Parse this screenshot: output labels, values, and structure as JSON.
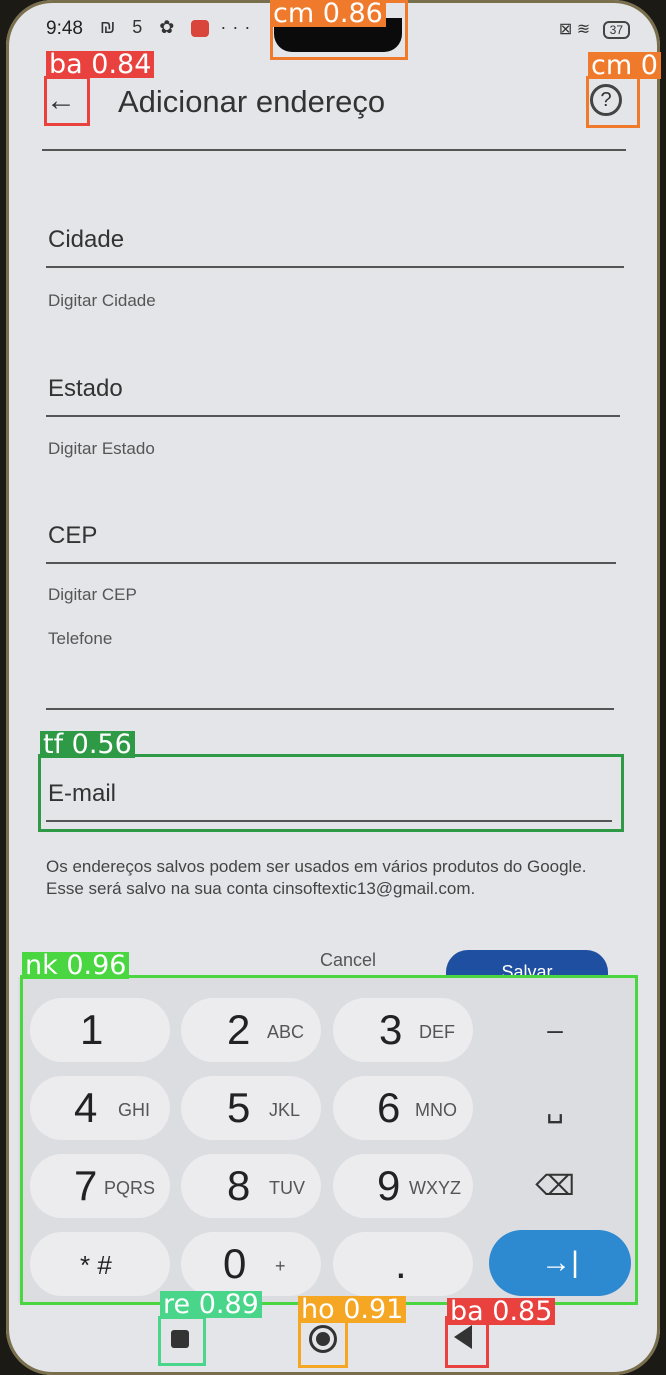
{
  "status_bar": {
    "time": "9:48",
    "left_icons": "₪ 5 ✿",
    "dots": "···",
    "right_icons": "⊠ ≋",
    "battery": "37"
  },
  "app_bar": {
    "back_glyph": "←",
    "title": "Adicionar endereço",
    "help_glyph": "?"
  },
  "form": {
    "city": {
      "label": "Cidade",
      "hint": "Digitar Cidade"
    },
    "state": {
      "label": "Estado",
      "hint": "Digitar Estado"
    },
    "zip": {
      "label": "CEP",
      "hint": "Digitar CEP"
    },
    "phone": {
      "label": "Telefone"
    },
    "email": {
      "label": "E-mail"
    }
  },
  "note": "Os endereços salvos podem ser usados em vários produtos do Google. Esse será salvo na sua conta cinsoftextic13@gmail.com.",
  "actions": {
    "cancel": "Cancel",
    "save": "Salvar"
  },
  "keyboard": {
    "keys": [
      {
        "digit": "1",
        "letters": ""
      },
      {
        "digit": "2",
        "letters": "ABC"
      },
      {
        "digit": "3",
        "letters": "DEF"
      },
      {
        "digit": "4",
        "letters": "GHI"
      },
      {
        "digit": "5",
        "letters": "JKL"
      },
      {
        "digit": "6",
        "letters": "MNO"
      },
      {
        "digit": "7",
        "letters": "PQRS"
      },
      {
        "digit": "8",
        "letters": "TUV"
      },
      {
        "digit": "9",
        "letters": "WXYZ"
      },
      {
        "digit": "* #",
        "letters": ""
      },
      {
        "digit": "0",
        "letters": "+"
      },
      {
        "digit": ".",
        "letters": ""
      }
    ],
    "side_keys": [
      "–",
      "␣",
      "⌫"
    ],
    "next_glyph": "→|"
  },
  "detections": [
    {
      "label": "cm 0.86",
      "color": "#f07a2b"
    },
    {
      "label": "ba 0.84",
      "color": "#e8413e"
    },
    {
      "label": "cm 0",
      "color": "#f07a2b"
    },
    {
      "label": "tf 0.56",
      "color": "#2e9a45"
    },
    {
      "label": "nk 0.96",
      "color": "#49d641"
    },
    {
      "label": "re 0.89",
      "color": "#49d68a"
    },
    {
      "label": "ho 0.91",
      "color": "#f5a623"
    },
    {
      "label": "ba 0.85",
      "color": "#e8413e"
    }
  ]
}
